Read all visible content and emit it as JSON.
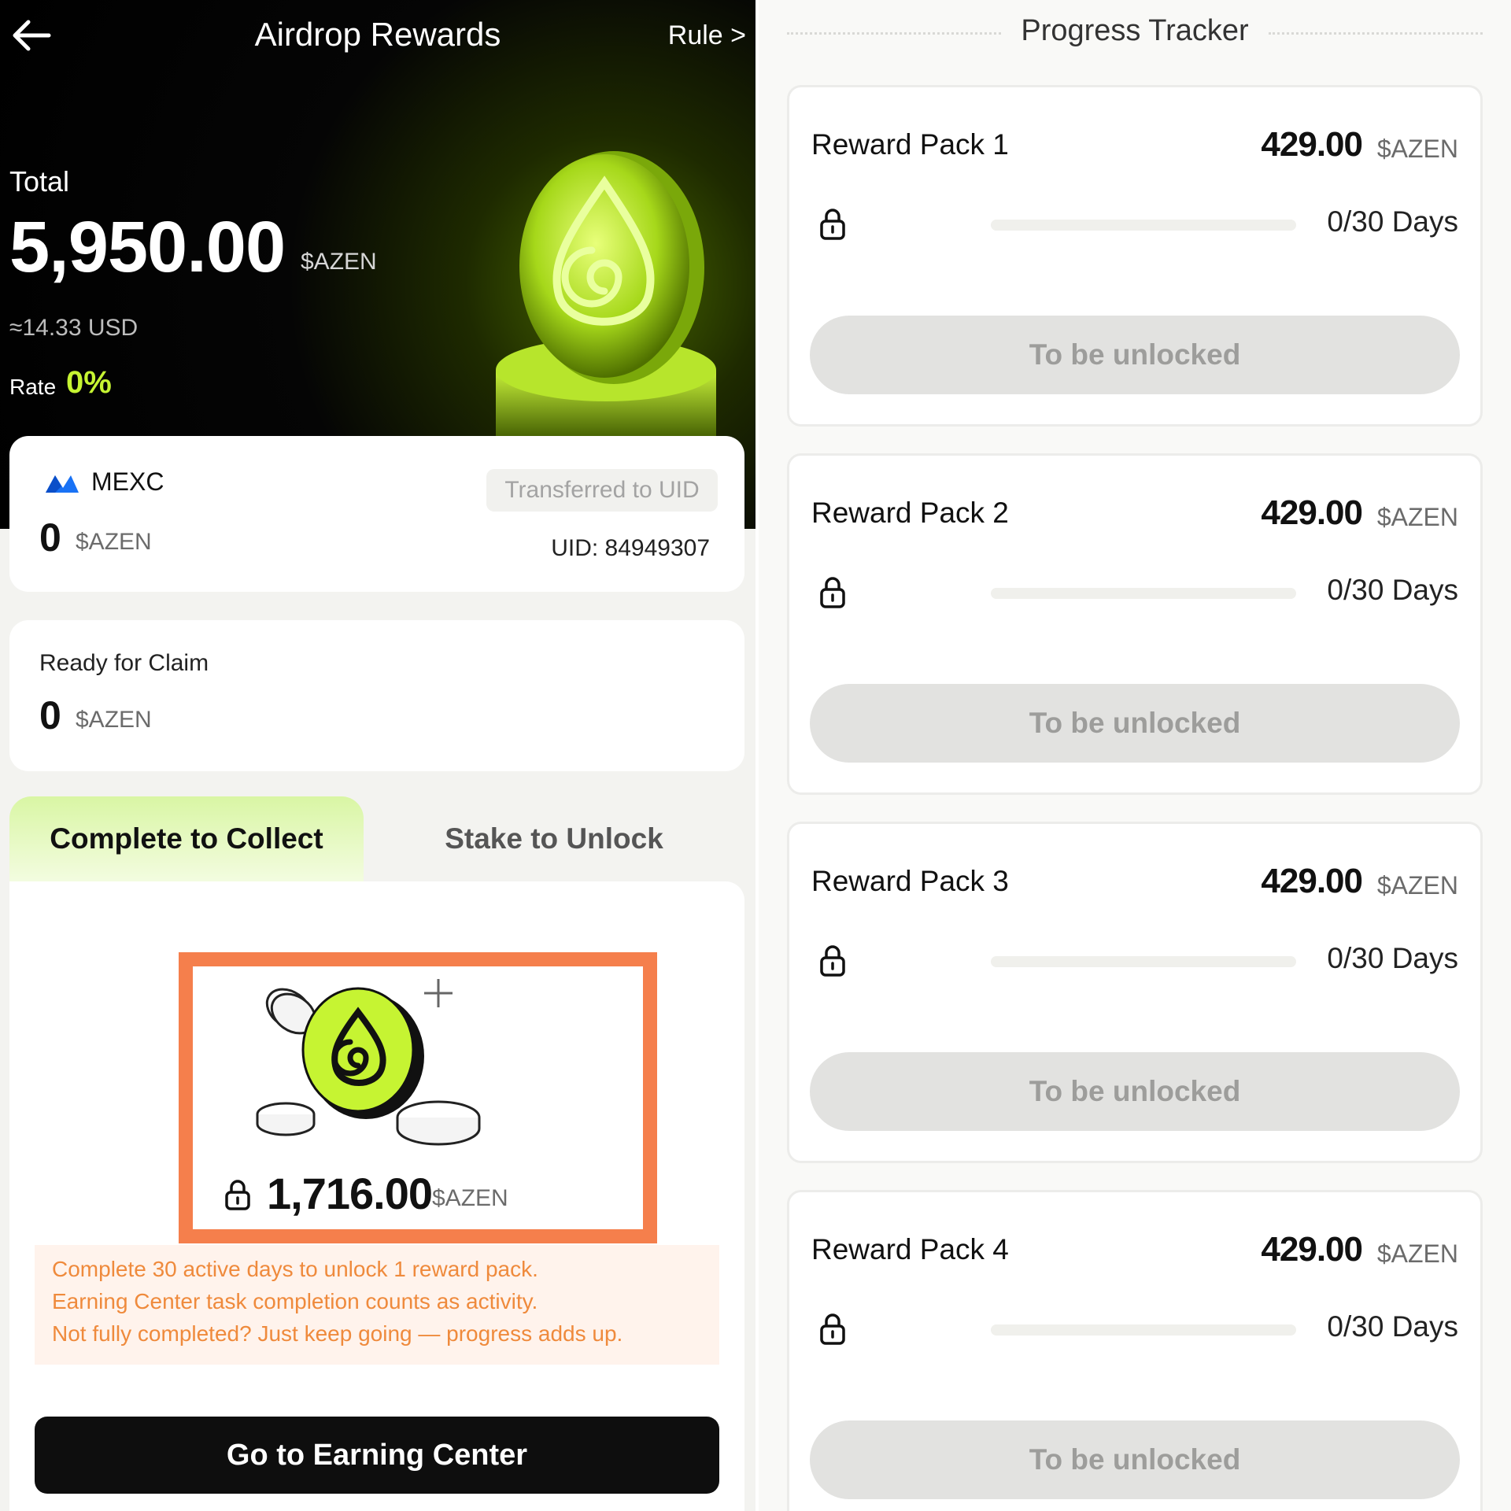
{
  "header": {
    "title": "Airdrop Rewards",
    "rule_link": "Rule >",
    "back_icon": "back-arrow-icon"
  },
  "summary": {
    "total_label": "Total",
    "total_value": "5,950.00",
    "total_unit": "$AZEN",
    "usd_value": "≈14.33 USD",
    "rate_label": "Rate",
    "rate_value": "0%"
  },
  "mexc_card": {
    "exchange_name": "MEXC",
    "value": "0",
    "unit": "$AZEN",
    "status_badge": "Transferred to UID",
    "uid": "UID: 84949307"
  },
  "claim_card": {
    "label": "Ready for Claim",
    "value": "0",
    "unit": "$AZEN"
  },
  "tabs": [
    {
      "label": "Complete to Collect",
      "active": true
    },
    {
      "label": "Stake to Unlock",
      "active": false
    }
  ],
  "collect": {
    "locked_amount": "1,716.00",
    "locked_unit": "$AZEN",
    "info_lines": [
      "Complete 30 active days to unlock 1 reward pack.",
      "Earning Center task completion counts as activity.",
      "Not fully completed? Just keep going — progress adds up."
    ],
    "button_label": "Go to Earning Center"
  },
  "tracker": {
    "title": "Progress Tracker",
    "packs": [
      {
        "name": "Reward Pack 1",
        "amount": "429.00",
        "unit": "$AZEN",
        "days_done": 0,
        "days_total": 30,
        "days_text": "0/30 Days",
        "button_label": "To be unlocked"
      },
      {
        "name": "Reward Pack 2",
        "amount": "429.00",
        "unit": "$AZEN",
        "days_done": 0,
        "days_total": 30,
        "days_text": "0/30 Days",
        "button_label": "To be unlocked"
      },
      {
        "name": "Reward Pack 3",
        "amount": "429.00",
        "unit": "$AZEN",
        "days_done": 0,
        "days_total": 30,
        "days_text": "0/30 Days",
        "button_label": "To be unlocked"
      },
      {
        "name": "Reward Pack 4",
        "amount": "429.00",
        "unit": "$AZEN",
        "days_done": 0,
        "days_total": 30,
        "days_text": "0/30 Days",
        "button_label": "To be unlocked"
      }
    ]
  },
  "colors": {
    "accent_green": "#c6f432",
    "highlight_orange": "#f57f4c",
    "info_text_orange": "#ef8a3c",
    "mexc_blue": "#1972f5"
  }
}
